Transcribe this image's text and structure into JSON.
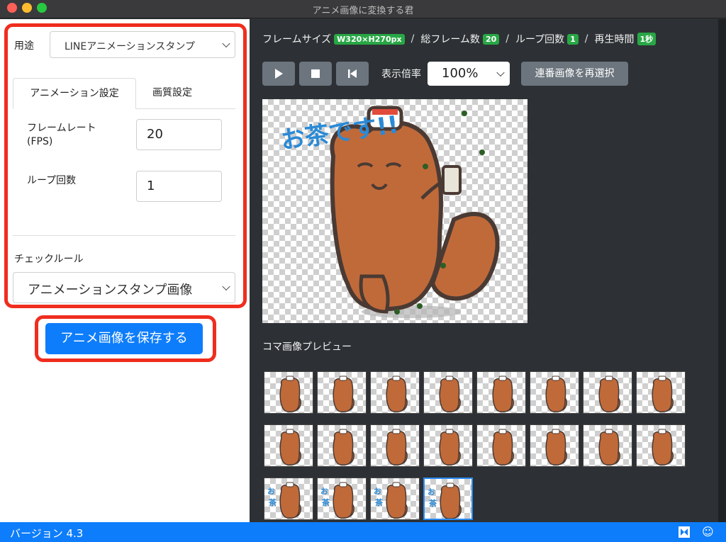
{
  "window": {
    "title": "アニメ画像に変換する君"
  },
  "left": {
    "usage_label": "用途",
    "usage_value": "LINEアニメーションスタンプ",
    "tabs": [
      {
        "label": "アニメーション設定"
      },
      {
        "label": "画質設定"
      }
    ],
    "framerate_label_line1": "フレームレート",
    "framerate_label_line2": "(FPS)",
    "framerate_value": "20",
    "loop_label": "ループ回数",
    "loop_value": "1",
    "checkrule_label": "チェックルール",
    "checkrule_value": "アニメーションスタンプ画像",
    "save_label": "アニメ画像を保存する"
  },
  "right": {
    "framesize_label": "フレームサイズ",
    "framesize_value": "W320×H270px",
    "total_frames_label": "総フレーム数",
    "total_frames_value": "20",
    "loops_label": "ループ回数",
    "loops_value": "1",
    "duration_label": "再生時間",
    "duration_value": "1秒",
    "controls": {
      "play_icon": "play-icon",
      "stop_icon": "stop-icon",
      "rewind_icon": "skip-back-icon"
    },
    "zoom_label": "表示倍率",
    "zoom_value": "100%",
    "reselect_label": "連番画像を再選択",
    "preview_text": "お茶です!!",
    "koma_title": "コマ画像プレビュー",
    "thumbnail_count": 20,
    "selected_thumbnail": 20
  },
  "statusbar": {
    "version": "バージョン 4.3",
    "icons": [
      "app-logo-icon",
      "smiley-icon"
    ]
  },
  "colors": {
    "accent": "#0d7dfb",
    "highlight_red": "#f02d1e",
    "badge_green": "#28a745",
    "dark_bg": "#2d3135"
  }
}
